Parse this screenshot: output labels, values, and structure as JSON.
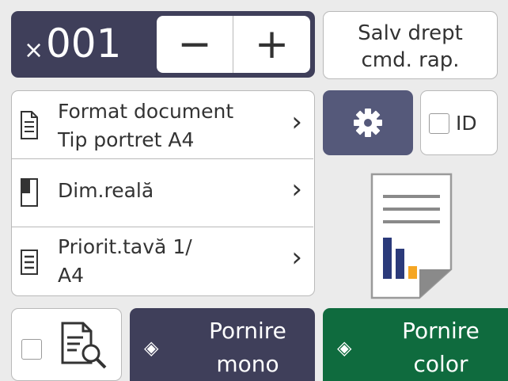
{
  "copies": {
    "prefix": "×",
    "value": "001",
    "minus": "−",
    "plus": "+"
  },
  "shortcut": {
    "line1": "Salv drept",
    "line2": "cmd. rap."
  },
  "menu": [
    {
      "line1": "Format document",
      "line2": "Tip portret A4",
      "icon": "document-format-icon"
    },
    {
      "line1": "Dim.reală",
      "line2": "",
      "icon": "page-size-icon"
    },
    {
      "line1": "Priorit.tavă 1/",
      "line2": "A4",
      "icon": "tray-icon"
    }
  ],
  "chevron": "›",
  "settings_icon": "gear-icon",
  "id_copy": {
    "label": "ID"
  },
  "preview_icon": "preview-search-icon",
  "buttons": {
    "mono": {
      "line1": "Pornire",
      "line2": "mono"
    },
    "color": {
      "line1": "Pornire",
      "line2": "color"
    },
    "start_symbol": "◈"
  },
  "colors": {
    "dark": "#3f3f5a",
    "green": "#0f6b3e",
    "background": "#ebebeb",
    "accent_orange": "#f5a623",
    "accent_navy": "#2b3a7a"
  }
}
